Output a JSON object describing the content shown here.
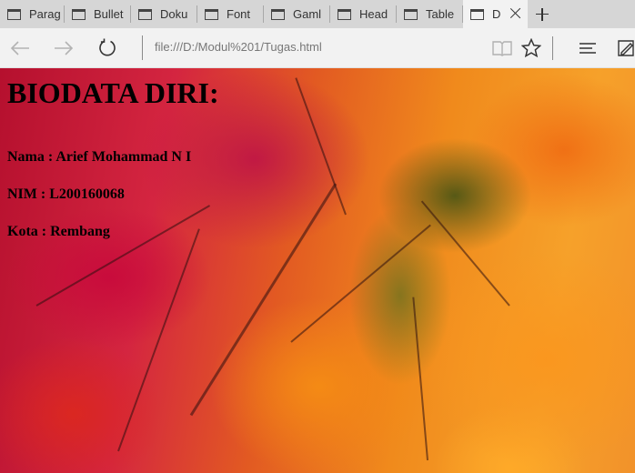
{
  "browser": {
    "tabs": [
      {
        "label": "Parag"
      },
      {
        "label": "Bullet"
      },
      {
        "label": "Doku"
      },
      {
        "label": "Font"
      },
      {
        "label": "Gaml"
      },
      {
        "label": "Head"
      },
      {
        "label": "Table"
      },
      {
        "label": "D",
        "active": true
      }
    ],
    "address": "file:///D:/Modul%201/Tugas.html",
    "icons": [
      "back-icon",
      "forward-icon",
      "refresh-icon",
      "reading-view-icon",
      "favorite-star-icon",
      "hub-icon",
      "web-note-icon"
    ]
  },
  "page": {
    "heading": "BIODATA DIRI:",
    "fields": [
      {
        "text": "Nama : Arief Mohammad N I"
      },
      {
        "text": "NIM : L200160068"
      },
      {
        "text": "Kota : Rembang"
      }
    ],
    "background": "autumn foliage photo"
  },
  "colors": {
    "tabstrip": "#d6d6d6",
    "toolbar": "#f2f2f2"
  }
}
